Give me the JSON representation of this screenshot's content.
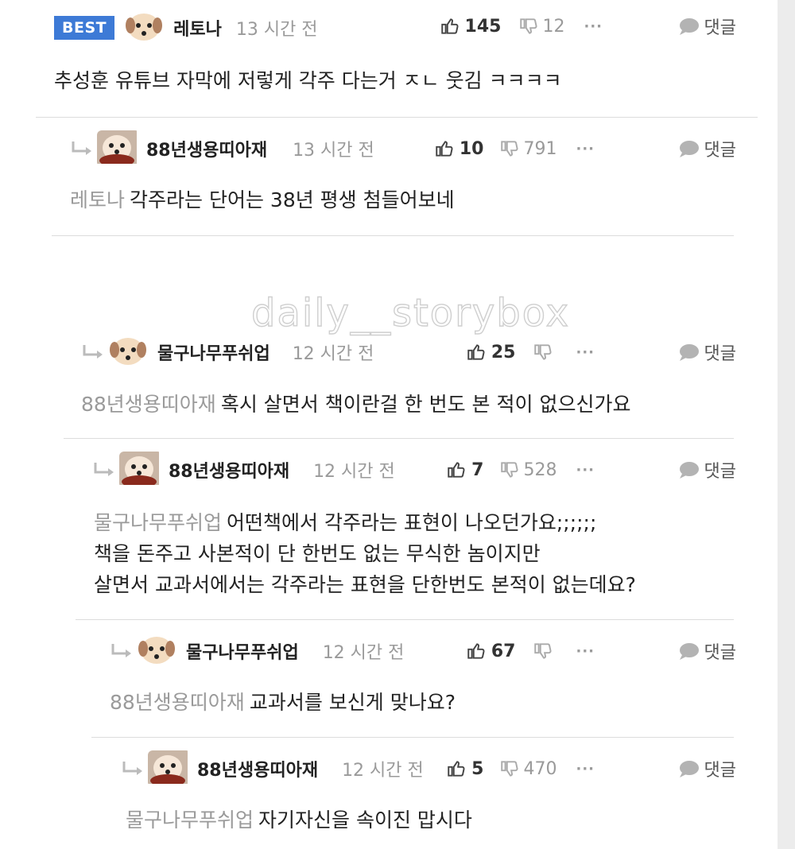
{
  "watermark": "daily__storybox",
  "best_label": "BEST",
  "reply_label": "댓글",
  "more_label": "···",
  "comments": [
    {
      "user": "레토나",
      "time": "13 시간 전",
      "likes": "145",
      "dislikes": "12",
      "mention": "",
      "body": [
        "추성훈 유튜브 자막에 저렇게 각주 다는거 ㅈㄴ 웃김 ㅋㅋㅋㅋ"
      ]
    },
    {
      "user": "88년생용띠아재",
      "time": "13 시간 전",
      "likes": "10",
      "dislikes": "791",
      "mention": "레토나",
      "body": [
        "각주라는 단어는 38년 평생 첨들어보네"
      ]
    },
    {
      "user": "물구나무푸쉬업",
      "time": "12 시간 전",
      "likes": "25",
      "dislikes": "",
      "mention": "88년생용띠아재",
      "body": [
        "혹시 살면서 책이란걸 한 번도 본 적이 없으신가요"
      ]
    },
    {
      "user": "88년생용띠아재",
      "time": "12 시간 전",
      "likes": "7",
      "dislikes": "528",
      "mention": "물구나무푸쉬업",
      "body": [
        "어떤책에서 각주라는 표현이 나오던가요;;;;;;",
        "책을 돈주고 사본적이 단 한번도 없는 무식한 놈이지만",
        "살면서 교과서에서는 각주라는 표현을 단한번도 본적이 없는데요?"
      ]
    },
    {
      "user": "물구나무푸쉬업",
      "time": "12 시간 전",
      "likes": "67",
      "dislikes": "",
      "mention": "88년생용띠아재",
      "body": [
        "교과서를 보신게 맞나요?"
      ]
    },
    {
      "user": "88년생용띠아재",
      "time": "12 시간 전",
      "likes": "5",
      "dislikes": "470",
      "mention": "물구나무푸쉬업",
      "body": [
        "자기자신을 속이진 맙시다"
      ]
    }
  ]
}
